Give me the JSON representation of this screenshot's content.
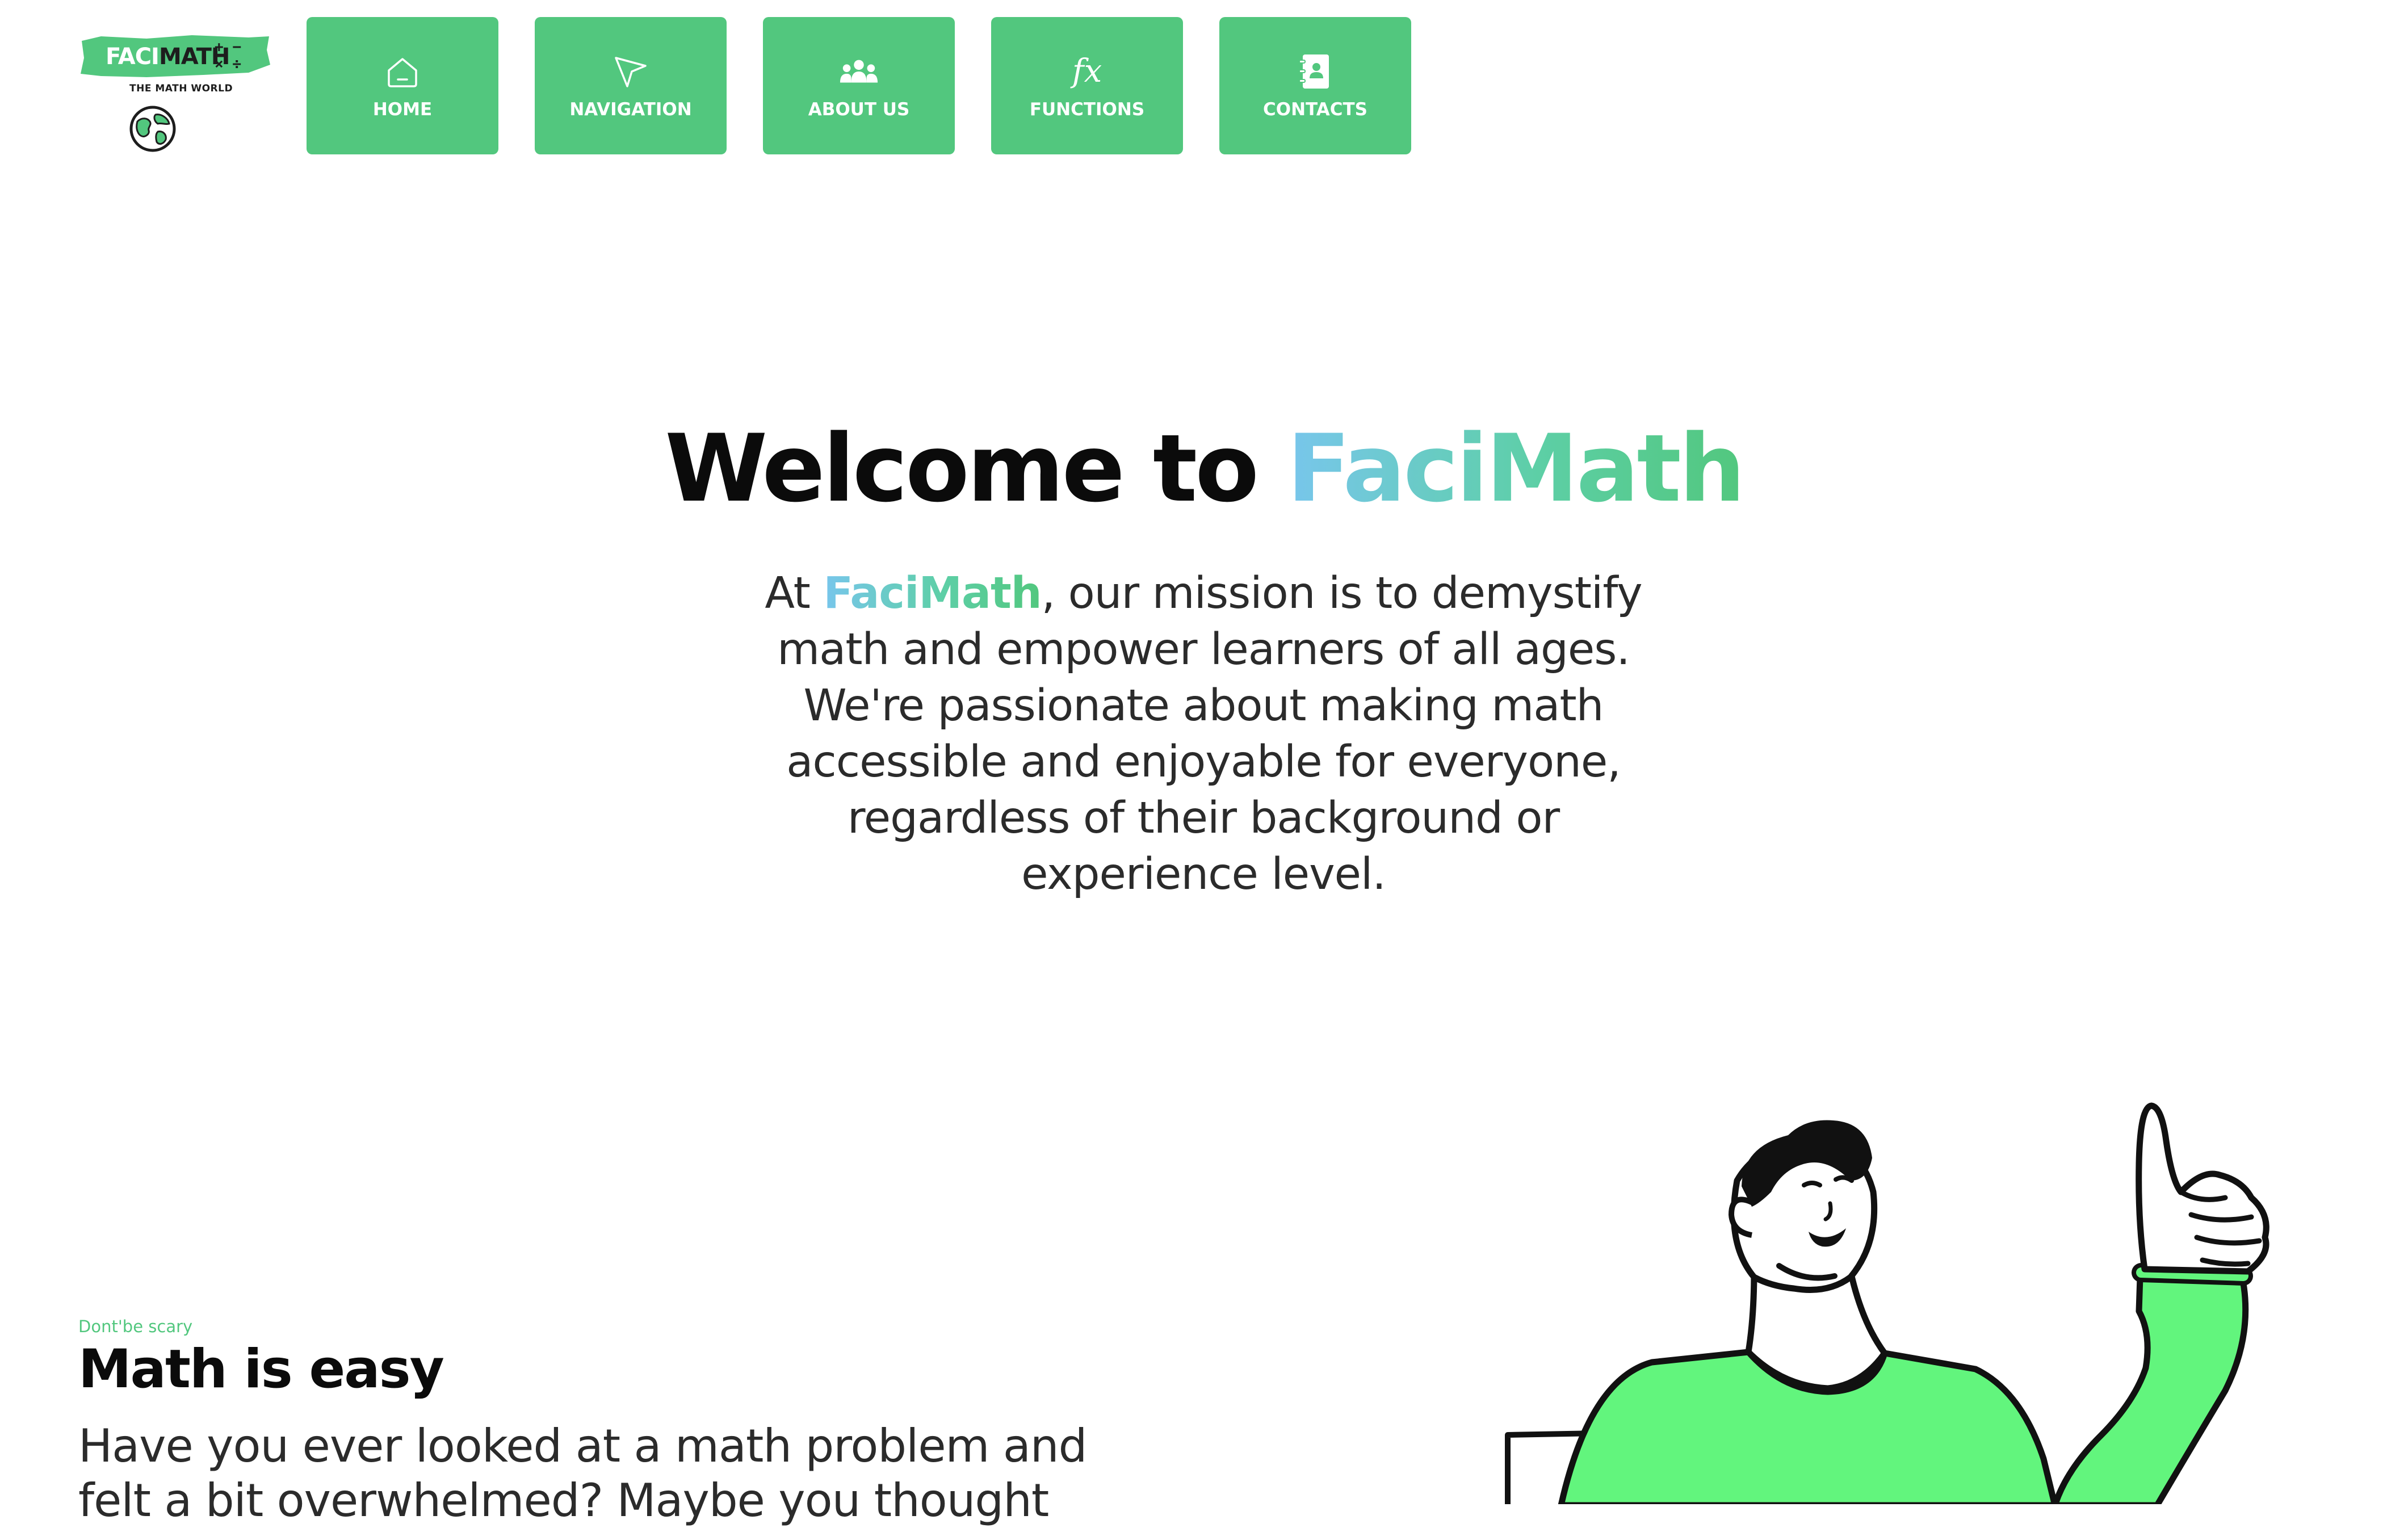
{
  "logo": {
    "faci": "FACI",
    "math": "MATH",
    "tagline": "THE MATH WORLD",
    "ops": [
      "+",
      "−",
      "×",
      "÷"
    ]
  },
  "nav": {
    "items": [
      {
        "label": "HOME",
        "icon": "home-icon"
      },
      {
        "label": "NAVIGATION",
        "icon": "cursor-arrow-icon"
      },
      {
        "label": "ABOUT US",
        "icon": "people-icon"
      },
      {
        "label": "FUNCTIONS",
        "icon": "fx-icon",
        "glyph": "fx"
      },
      {
        "label": "CONTACTS",
        "icon": "contact-book-icon"
      }
    ]
  },
  "hero": {
    "title_prefix": "Welcome to",
    "title_brand": "FaciMath",
    "text_prefix": "At",
    "text_brand": "FaciMath",
    "text_rest": ", our mission is to demystify math and empower learners of all ages. We're passionate about making math accessible and enjoyable for everyone, regardless of their background or experience level."
  },
  "section": {
    "eyebrow": "Dont'be scary",
    "title": "Math is easy",
    "text": "Have you ever looked at a math problem and felt a bit overwhelmed? Maybe you thought"
  },
  "colors": {
    "brand_green": "#52c77e",
    "brand_blue": "#78c6ec",
    "illustration_green": "#62f57d",
    "text_dark": "#0b0b0b"
  }
}
